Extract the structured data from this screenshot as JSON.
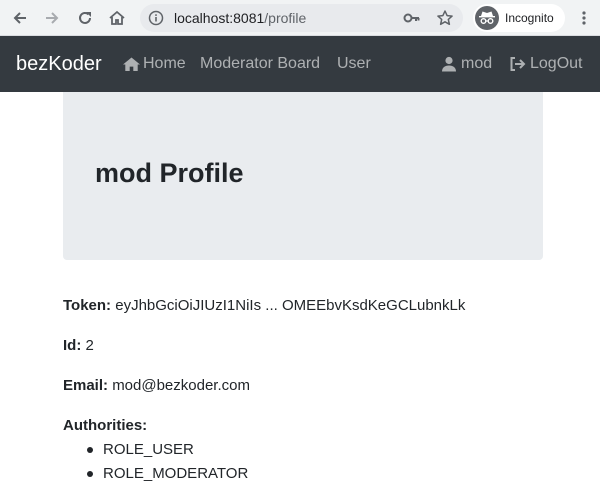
{
  "browser": {
    "url_host": "localhost:8081",
    "url_path": "/profile",
    "incognito_label": "Incognito",
    "icons": [
      "back-icon",
      "forward-icon",
      "reload-icon",
      "home-icon",
      "info-icon",
      "key-icon",
      "star-icon",
      "incognito-icon",
      "menu-icon"
    ]
  },
  "navbar": {
    "brand": "bezKoder",
    "home": "Home",
    "moderator_board": "Moderator Board",
    "user": "User",
    "username": "mod",
    "logout": "LogOut"
  },
  "profile": {
    "username": "mod",
    "title_suffix": "Profile",
    "token_label": "Token:",
    "token_value": "eyJhbGciOiJIUzI1NiIs ... OMEEbvKsdKeGCLubnkLk",
    "id_label": "Id:",
    "id_value": "2",
    "email_label": "Email:",
    "email_value": "mod@bezkoder.com",
    "authorities_label": "Authorities:",
    "authorities": [
      "ROLE_USER",
      "ROLE_MODERATOR"
    ]
  }
}
